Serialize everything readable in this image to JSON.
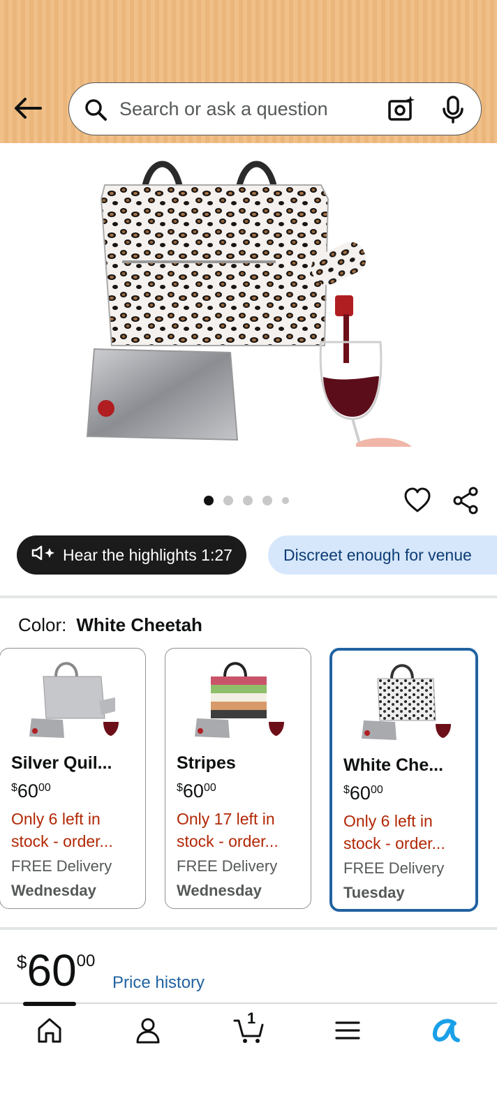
{
  "search": {
    "placeholder": "Search or ask a question"
  },
  "gallery": {
    "image_count": 5,
    "active_index": 0
  },
  "chips": {
    "highlights": "Hear the highlights 1:27",
    "question": "Discreet enough for venue"
  },
  "color": {
    "label": "Color:",
    "selected": "White Cheetah"
  },
  "variants": [
    {
      "name": "Silver Quil...",
      "price_whole": "60",
      "price_frac": "00",
      "currency": "$",
      "stock_line1": "Only 6 left in",
      "stock_line2": "stock - order...",
      "delivery": "FREE Delivery",
      "day": "Wednesday"
    },
    {
      "name": "Stripes",
      "price_whole": "60",
      "price_frac": "00",
      "currency": "$",
      "stock_line1": "Only 17 left in",
      "stock_line2": "stock - order...",
      "delivery": "FREE Delivery",
      "day": "Wednesday"
    },
    {
      "name": "White Che...",
      "price_whole": "60",
      "price_frac": "00",
      "currency": "$",
      "stock_line1": "Only 6 left in",
      "stock_line2": "stock - order...",
      "delivery": "FREE Delivery",
      "day": "Tuesday"
    }
  ],
  "price": {
    "currency": "$",
    "whole": "60",
    "fraction": "00",
    "history_link": "Price history"
  },
  "cart": {
    "count": "1"
  },
  "colors": {
    "accent_blue": "#2162a1",
    "stock_red": "#b12704",
    "header_bg": "#f1c088"
  }
}
